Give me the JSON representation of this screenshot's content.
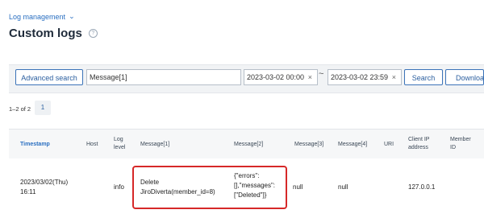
{
  "header": {
    "breadcrumb": "Log management",
    "title": "Custom logs",
    "help_icon": "?"
  },
  "search": {
    "advanced_label": "Advanced search",
    "message_field_value": "Message[1]",
    "date_from": "2023-03-02 00:00",
    "date_to": "2023-03-02 23:59",
    "range_separator": "~",
    "clear_symbol": "×",
    "search_label": "Search",
    "download_label": "Download"
  },
  "pagination": {
    "summary": "1–2 of 2",
    "current_page": "1"
  },
  "table": {
    "headers": {
      "timestamp": "Timestamp",
      "host": "Host",
      "log_level_1": "Log",
      "log_level_2": "level",
      "message1": "Message[1]",
      "message2": "Message[2]",
      "message3": "Message[3]",
      "message4": "Message[4]",
      "uri": "URI",
      "client_ip_1": "Client IP",
      "client_ip_2": "address",
      "member_id_1": "Member",
      "member_id_2": "ID"
    },
    "rows": [
      {
        "timestamp_1": "2023/03/02(Thu)",
        "timestamp_2": "16:11",
        "host": "",
        "log_level": "info",
        "message1_1": "Delete",
        "message1_2": "JiroDiverta(member_id=8)",
        "message2_1": "{\"errors\":",
        "message2_2": "[],\"messages\":",
        "message2_3": "[\"Deleted\"]}",
        "message3": "null",
        "message4": "null",
        "uri": "",
        "client_ip": "127.0.0.1",
        "member_id": ""
      }
    ]
  },
  "colors": {
    "accent": "#2a6fc1",
    "highlight": "#d62828"
  }
}
